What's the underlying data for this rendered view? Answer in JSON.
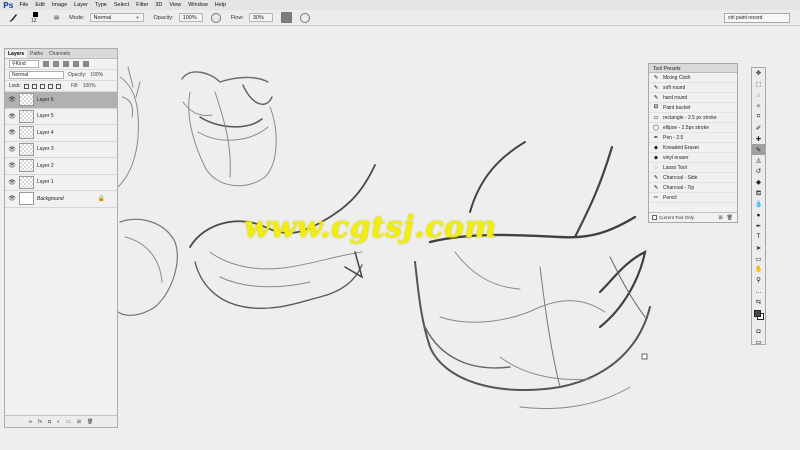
{
  "app": {
    "logo": "Ps"
  },
  "menu": [
    "File",
    "Edit",
    "Image",
    "Layer",
    "Type",
    "Select",
    "Filter",
    "3D",
    "View",
    "Window",
    "Help"
  ],
  "options_bar": {
    "brush_size": "12",
    "mode_label": "Mode:",
    "mode_value": "Normal",
    "opacity_label": "Opacity:",
    "opacity_value": "100%",
    "flow_label": "Flow:",
    "flow_value": "30%",
    "workspace": "ctrl paint record"
  },
  "layers_panel": {
    "tabs": [
      "Layers",
      "Paths",
      "Channels"
    ],
    "kind_filter": "Kind",
    "blend_mode": "Normal",
    "opacity_label": "Opacity:",
    "opacity_value": "100%",
    "lock_label": "Lock:",
    "fill_label": "Fill:",
    "fill_value": "100%",
    "layers": [
      {
        "name": "Layer 6",
        "selected": true
      },
      {
        "name": "Layer 5",
        "selected": false
      },
      {
        "name": "Layer 4",
        "selected": false
      },
      {
        "name": "Layer 3",
        "selected": false
      },
      {
        "name": "Layer 2",
        "selected": false
      },
      {
        "name": "Layer 1",
        "selected": false
      },
      {
        "name": "Background",
        "selected": false,
        "locked": true
      }
    ]
  },
  "tool_presets": {
    "title": "Tool Presets",
    "items": [
      {
        "icon": "brush-icon",
        "label": "Mixing Cloth"
      },
      {
        "icon": "brush-icon",
        "label": "soft round"
      },
      {
        "icon": "brush-icon",
        "label": "hard round"
      },
      {
        "icon": "paint-bucket-icon",
        "label": "Paint bucket"
      },
      {
        "icon": "rectangle-icon",
        "label": "rectangle - 2.5 px stroke"
      },
      {
        "icon": "ellipse-icon",
        "label": "ellipse - 2.5px stroke"
      },
      {
        "icon": "pen-icon",
        "label": "Pen - 2.5"
      },
      {
        "icon": "eraser-icon",
        "label": "Kneaded Eraser"
      },
      {
        "icon": "eraser-icon",
        "label": "vinyl eraser"
      },
      {
        "icon": "lasso-icon",
        "label": "Lasso Tool"
      },
      {
        "icon": "brush-icon",
        "label": "Charcoal - Side"
      },
      {
        "icon": "brush-icon",
        "label": "Charcoal - Tip"
      },
      {
        "icon": "pencil-icon",
        "label": "Pencil"
      }
    ],
    "current_tool_only": "Current Tool Only"
  },
  "watermark": "www.cgtsj.com"
}
